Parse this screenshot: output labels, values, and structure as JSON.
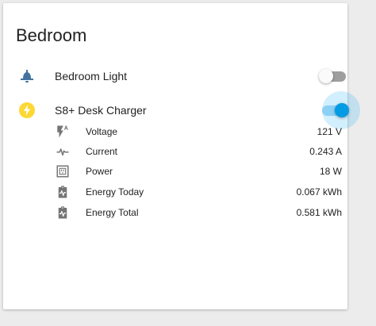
{
  "card": {
    "title": "Bedroom"
  },
  "entities": [
    {
      "name": "Bedroom Light",
      "icon": "bell-lamp-icon",
      "state": "off"
    },
    {
      "name": "S8+ Desk Charger",
      "icon": "flash-icon",
      "state": "on"
    }
  ],
  "attributes": [
    {
      "label": "Voltage",
      "value": "121 V",
      "icon": "flash-auto-icon"
    },
    {
      "label": "Current",
      "value": "0.243 A",
      "icon": "pulse-icon"
    },
    {
      "label": "Power",
      "value": "18 W",
      "icon": "power-socket-icon"
    },
    {
      "label": "Energy Today",
      "value": "0.067 kWh",
      "icon": "clipboard-pulse-icon"
    },
    {
      "label": "Energy Total",
      "value": "0.581 kWh",
      "icon": "clipboard-pulse-icon"
    }
  ],
  "colors": {
    "icon_blue": "#44739e",
    "icon_active": "#fdd835",
    "toggle_on": "#039be5",
    "toggle_off": "#9e9e9e",
    "attr_icon": "#757575"
  }
}
